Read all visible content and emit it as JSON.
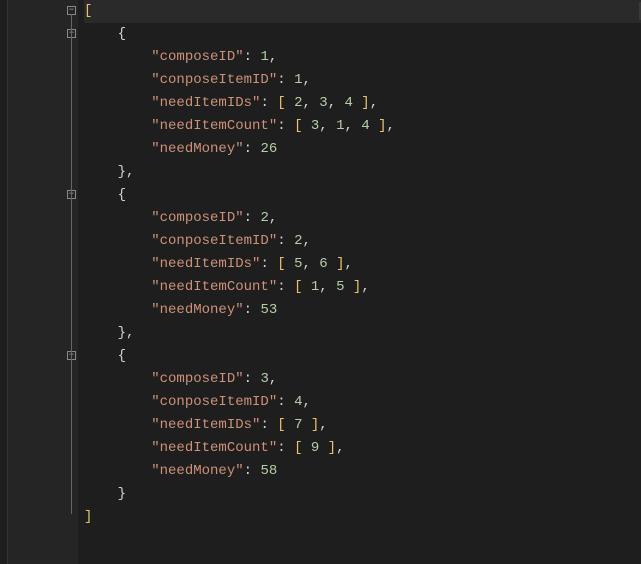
{
  "code": {
    "entries": [
      {
        "composeID": 1,
        "conposeItemID": 1,
        "needItemIDs": [
          2,
          3,
          4
        ],
        "needItemCount": [
          3,
          1,
          4
        ],
        "needMoney": 26
      },
      {
        "composeID": 2,
        "conposeItemID": 2,
        "needItemIDs": [
          5,
          6
        ],
        "needItemCount": [
          1,
          5
        ],
        "needMoney": 53
      },
      {
        "composeID": 3,
        "conposeItemID": 4,
        "needItemIDs": [
          7
        ],
        "needItemCount": [
          9
        ],
        "needMoney": 58
      }
    ],
    "keys": {
      "composeID": "\"composeID\"",
      "conposeItemID": "\"conposeItemID\"",
      "needItemIDs": "\"needItemIDs\"",
      "needItemCount": "\"needItemCount\"",
      "needMoney": "\"needMoney\""
    }
  },
  "fold": {
    "minus": "−"
  }
}
